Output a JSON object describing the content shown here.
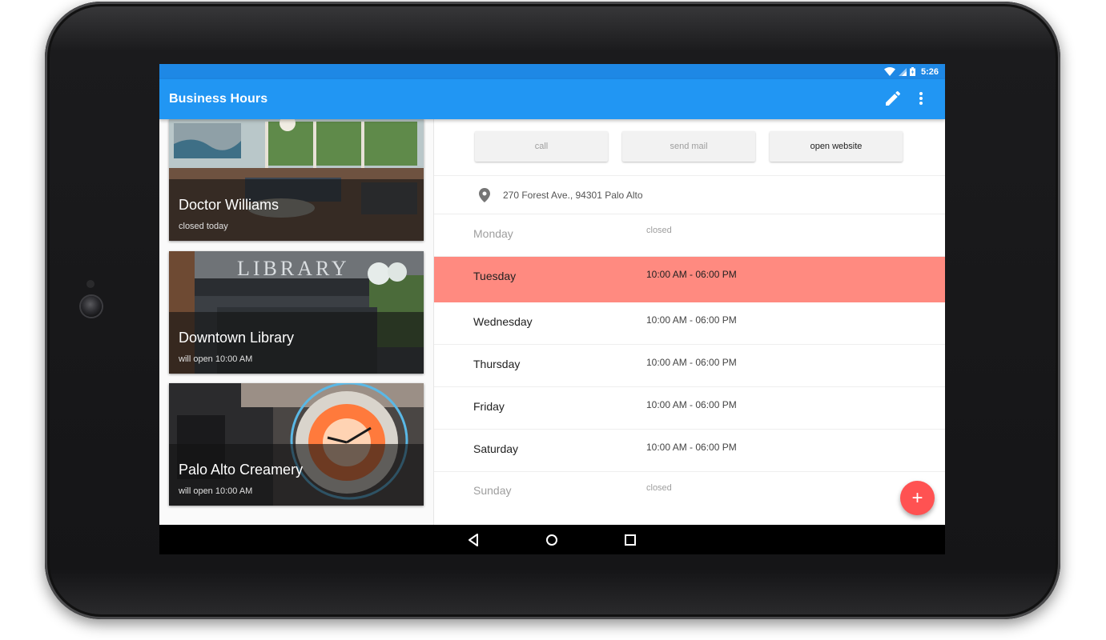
{
  "status_bar": {
    "time": "5:26"
  },
  "toolbar": {
    "title": "Business Hours",
    "edit_icon": "pencil-icon",
    "more_icon": "more-vert-icon"
  },
  "businesses": [
    {
      "name": "Doctor Williams",
      "status": "closed today"
    },
    {
      "name": "Downtown Library",
      "status": "will open 10:00 AM"
    },
    {
      "name": "Palo Alto Creamery",
      "status": "will open 10:00 AM"
    }
  ],
  "actions": {
    "call": "call",
    "send_mail": "send mail",
    "open_website": "open website"
  },
  "address": "270 Forest Ave., 94301 Palo Alto",
  "hours": [
    {
      "day": "Monday",
      "hours": "closed"
    },
    {
      "day": "Tuesday",
      "hours": "10:00 AM - 06:00 PM"
    },
    {
      "day": "Wednesday",
      "hours": "10:00 AM - 06:00 PM"
    },
    {
      "day": "Thursday",
      "hours": "10:00 AM - 06:00 PM"
    },
    {
      "day": "Friday",
      "hours": "10:00 AM - 06:00 PM"
    },
    {
      "day": "Saturday",
      "hours": "10:00 AM - 06:00 PM"
    },
    {
      "day": "Sunday",
      "hours": "closed"
    }
  ],
  "fab_label": "+",
  "colors": {
    "primary": "#2196f3",
    "primary_dark": "#1e88e5",
    "today_highlight": "#ff8a80",
    "accent": "#ff5252"
  }
}
